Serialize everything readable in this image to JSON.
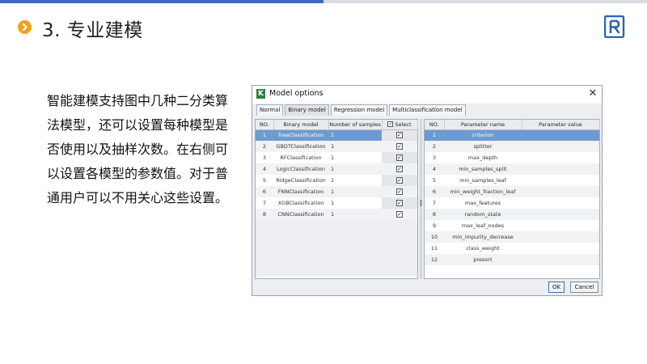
{
  "slide": {
    "title": "3. 专业建模",
    "description": "智能建模支持图中几种二分类算法模型，还可以设置每种模型是否使用以及抽样次数。在右侧可以设置各模型的参数值。对于普通用户可以不用关心这些设置。",
    "colors": {
      "accent_blue": "#3a6fb7",
      "bullet_orange": "#f2a21b",
      "selection": "#6d9ad1"
    }
  },
  "dialog": {
    "title": "Model options",
    "app_icon_letter": "K",
    "tabs": [
      {
        "label": "Normal",
        "active": false
      },
      {
        "label": "Binary model",
        "active": true
      },
      {
        "label": "Regression model",
        "active": false
      },
      {
        "label": "Multiclassification model",
        "active": false
      }
    ],
    "models_table": {
      "headers": [
        "NO.",
        "Binary model",
        "Number of samples",
        "Select"
      ],
      "rows": [
        {
          "no": "1",
          "name": "TreeClassification",
          "samples": "1",
          "selected": true
        },
        {
          "no": "2",
          "name": "GBDTClassification",
          "samples": "1",
          "selected": true
        },
        {
          "no": "3",
          "name": "RFClassification",
          "samples": "1",
          "selected": true
        },
        {
          "no": "4",
          "name": "LogicClassification",
          "samples": "1",
          "selected": true
        },
        {
          "no": "5",
          "name": "RidgeClassification",
          "samples": "1",
          "selected": true
        },
        {
          "no": "6",
          "name": "FNNClassification",
          "samples": "1",
          "selected": true
        },
        {
          "no": "7",
          "name": "XGBClassification",
          "samples": "1",
          "selected": true
        },
        {
          "no": "8",
          "name": "CNNClassification",
          "samples": "1",
          "selected": true
        }
      ],
      "selected_row": 0
    },
    "params_table": {
      "headers": [
        "NO.",
        "Parameter name",
        "Parameter value"
      ],
      "rows": [
        {
          "no": "1",
          "name": "criterion",
          "value": ""
        },
        {
          "no": "2",
          "name": "splitter",
          "value": ""
        },
        {
          "no": "3",
          "name": "max_depth",
          "value": ""
        },
        {
          "no": "4",
          "name": "min_samples_split",
          "value": ""
        },
        {
          "no": "5",
          "name": "min_samples_leaf",
          "value": ""
        },
        {
          "no": "6",
          "name": "min_weight_fraction_leaf",
          "value": ""
        },
        {
          "no": "7",
          "name": "max_features",
          "value": ""
        },
        {
          "no": "8",
          "name": "random_state",
          "value": ""
        },
        {
          "no": "9",
          "name": "max_leaf_nodes",
          "value": ""
        },
        {
          "no": "10",
          "name": "min_impurity_decrease",
          "value": ""
        },
        {
          "no": "11",
          "name": "class_weight",
          "value": ""
        },
        {
          "no": "12",
          "name": "presort",
          "value": ""
        }
      ],
      "selected_row": 0
    },
    "buttons": {
      "ok": "OK",
      "cancel": "Cancel"
    }
  }
}
